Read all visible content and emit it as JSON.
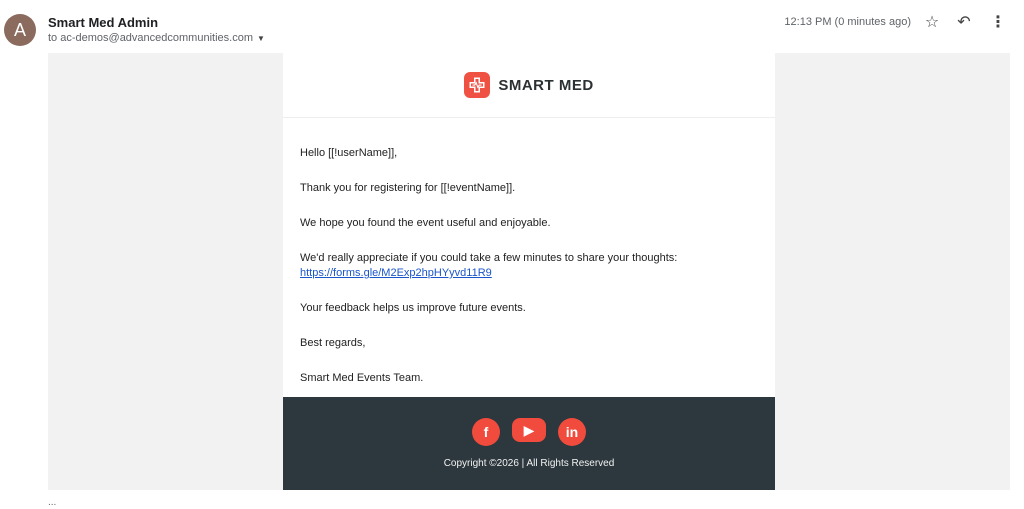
{
  "header": {
    "avatar_letter": "A",
    "sender_name": "Smart Med Admin",
    "recipient_text": "to ac-demos@advancedcommunities.com",
    "timestamp": "12:13 PM (0 minutes ago)",
    "actions": [
      "star-icon",
      "reply-icon",
      "more-icon"
    ]
  },
  "email": {
    "brand": "SMART MED",
    "lines": {
      "greeting": "Hello [[!userName]],",
      "thanks": "Thank you for registering for [[!eventName]].",
      "hope": "We hope you found the event useful and enjoyable.",
      "ask_prefix": "We'd really appreciate if you could take a few minutes to share your thoughts: ",
      "link": "https://forms.gle/M2Exp2hpHYyvd11R9",
      "feedback": "Your feedback helps us improve future events.",
      "best": "Best regards,",
      "team": "Smart Med Events Team."
    },
    "footer": {
      "icons": [
        "facebook-icon",
        "youtube-icon",
        "linkedin-icon"
      ],
      "copyright": "Copyright ©2026 | All Rights Reserved"
    }
  },
  "trailing_text": "..."
}
